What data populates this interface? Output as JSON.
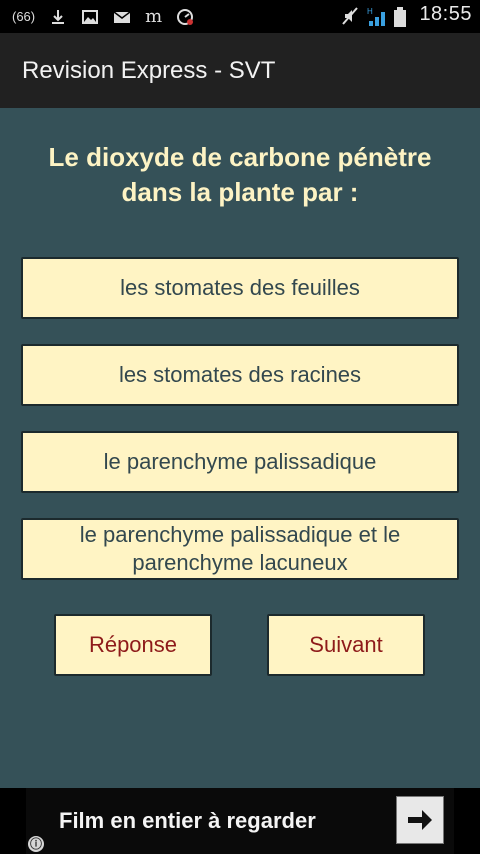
{
  "status_bar": {
    "left_icons": [
      "bbm-icon",
      "download-icon",
      "image-icon",
      "mail-icon",
      "newspaper-icon",
      "speedometer-icon"
    ],
    "bbm_text": "(66)",
    "newspaper_text": "m",
    "time": "18:55"
  },
  "app_bar": {
    "title": "Revision Express - SVT"
  },
  "quiz": {
    "question": "Le dioxyde de carbone pénètre dans la plante par :",
    "answers": [
      "les stomates des feuilles",
      "les stomates des racines",
      "le parenchyme palissadique",
      "le parenchyme palissadique et  le parenchyme lacuneux"
    ],
    "answer_button_label": "Réponse",
    "next_button_label": "Suivant"
  },
  "ad_banner": {
    "text": "Film en entier à regarder",
    "info_icon": "ⓘ"
  },
  "colors": {
    "background": "#355158",
    "question_text": "#fdf3c4",
    "button_fill": "#fff4c4",
    "answer_text": "#33484e",
    "action_text": "#8e1a1a",
    "appbar": "#212121"
  }
}
